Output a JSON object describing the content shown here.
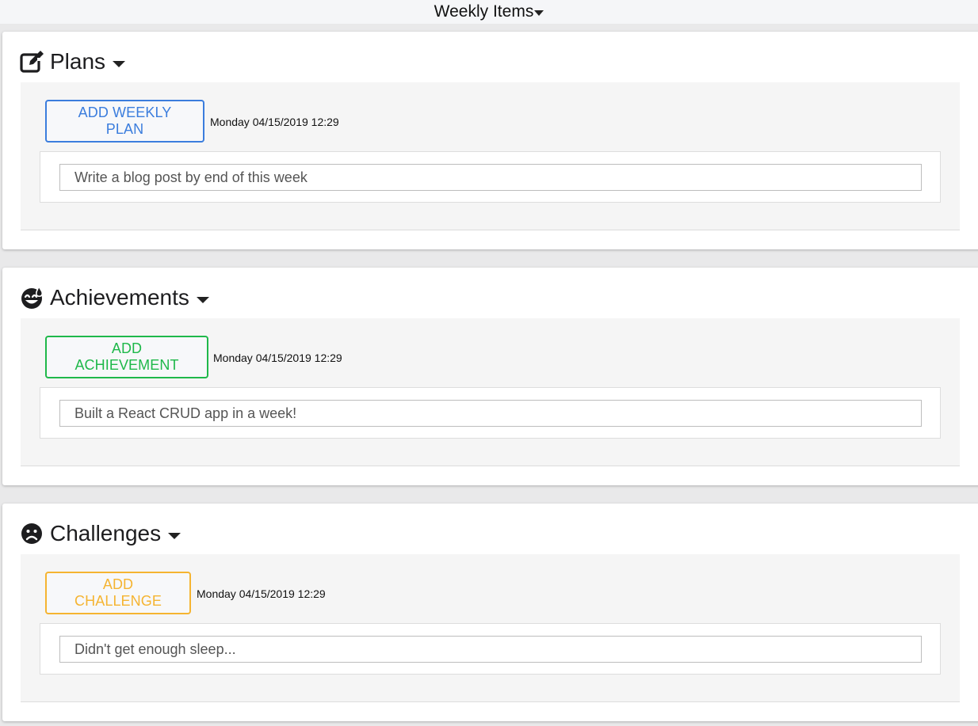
{
  "header": {
    "title": "Weekly Items"
  },
  "sections": [
    {
      "title": "Plans",
      "icon": "edit-icon",
      "button_label": "ADD WEEKLY PLAN",
      "button_color": "#3b7ddd",
      "timestamp": "Monday 04/15/2019 12:29",
      "entry_value": "Write a blog post by end of this week"
    },
    {
      "title": "Achievements",
      "icon": "grin-beam-sweat-icon",
      "button_label": "ADD ACHIEVEMENT",
      "button_color": "#1fb84a",
      "timestamp": "Monday 04/15/2019 12:29",
      "entry_value": "Built a React CRUD app in a week!"
    },
    {
      "title": "Challenges",
      "icon": "frown-icon",
      "button_label": "ADD CHALLENGE",
      "button_color": "#f5b431",
      "timestamp": "Monday 04/15/2019 12:29",
      "entry_value": "Didn't get enough sleep..."
    }
  ]
}
